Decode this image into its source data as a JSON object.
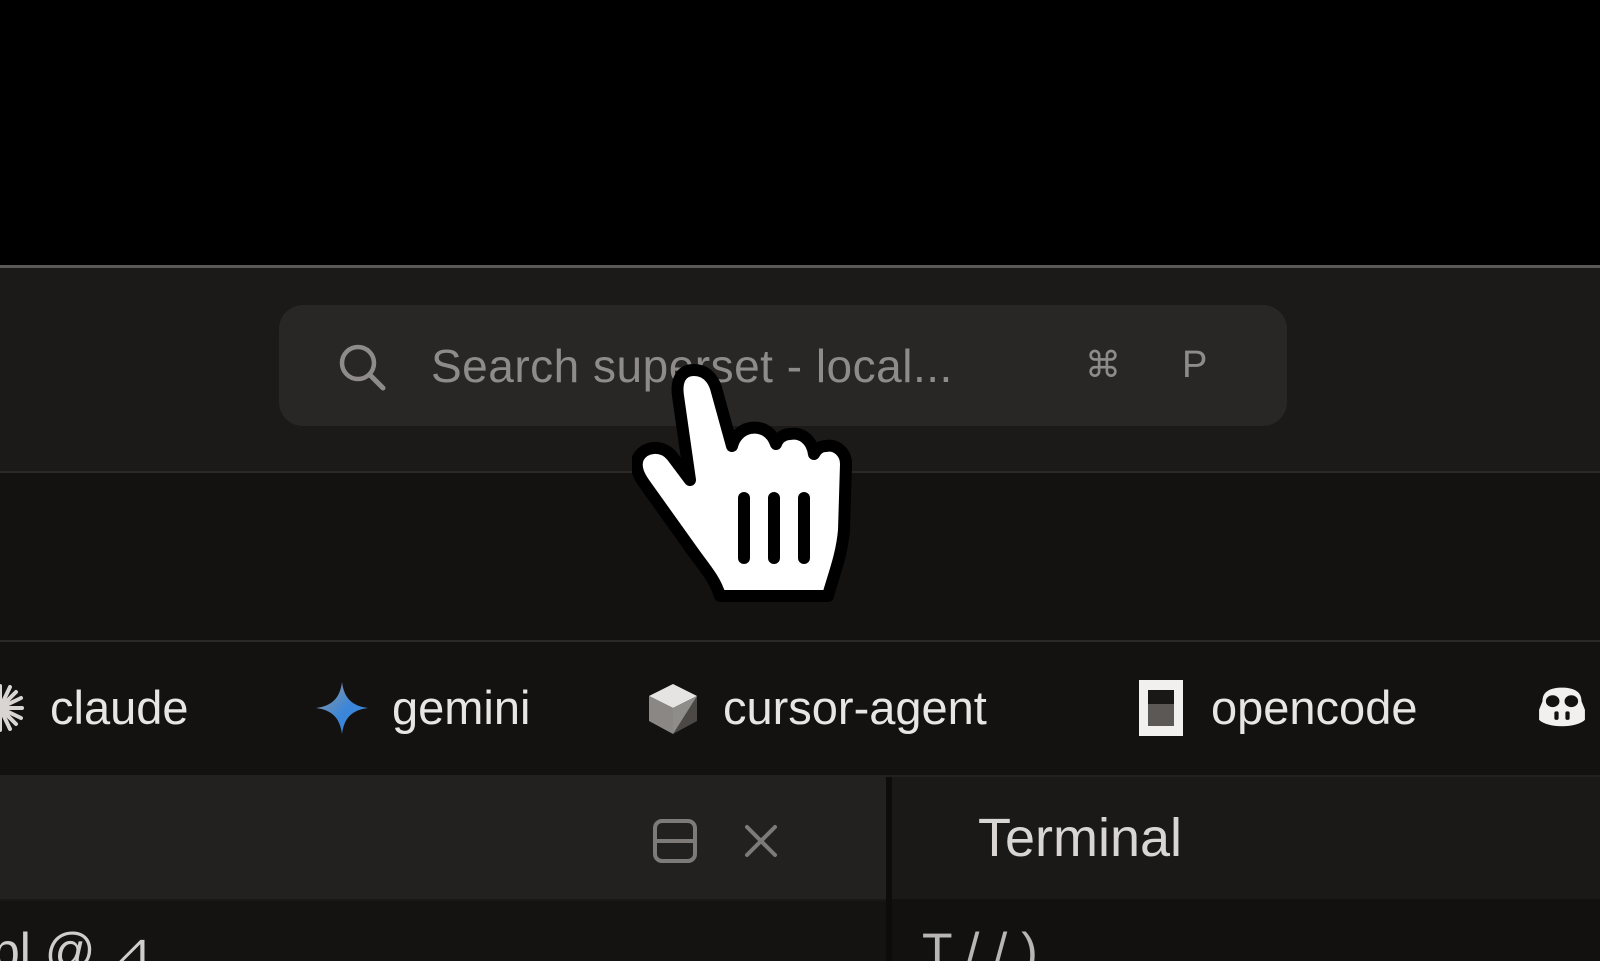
{
  "search": {
    "placeholder": "Search superset - local...",
    "shortcut_modifier": "⌘",
    "shortcut_key": "P"
  },
  "agents": [
    {
      "label": "claude",
      "icon": "claude-starburst-icon"
    },
    {
      "label": "gemini",
      "icon": "gemini-sparkle-icon"
    },
    {
      "label": "cursor-agent",
      "icon": "cursor-cube-icon"
    },
    {
      "label": "opencode",
      "icon": "opencode-square-icon"
    },
    {
      "label": "",
      "icon": "copilot-robot-icon"
    }
  ],
  "left_pane": {
    "split_icon": "split-horizontal-icon",
    "close_icon": "close-icon",
    "body_partial_text": "bl    @    ⊿"
  },
  "right_pane": {
    "tab_label": "Terminal",
    "body_partial_text": "T  /  /    )"
  },
  "cursor": {
    "icon": "hand-pointer-cursor"
  },
  "colors": {
    "background": "#000000",
    "window": "#131110",
    "titlebar": "#1c1a19",
    "search_box": "#292726",
    "text_muted": "#8e8b89",
    "text_primary": "#e8e6e4",
    "gemini_blue": "#3b86d9"
  }
}
